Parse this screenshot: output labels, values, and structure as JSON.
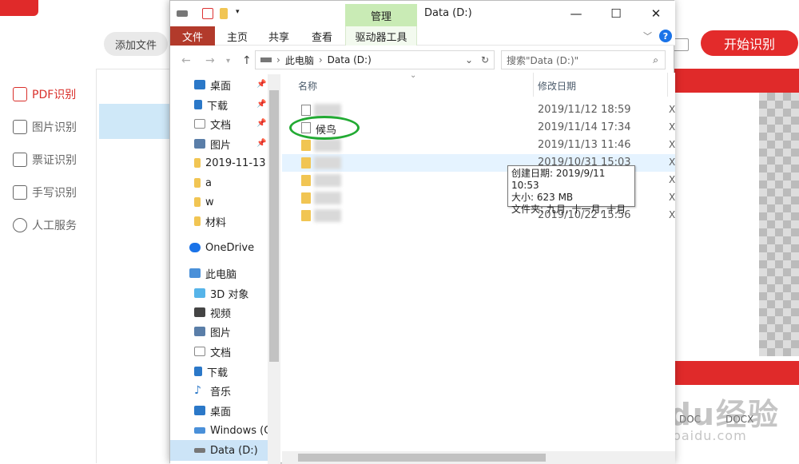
{
  "ocr_app": {
    "add_file": "添加文件",
    "start": "开始识别",
    "sidebar": [
      {
        "label": "PDF识别",
        "icon": "pdf-icon"
      },
      {
        "label": "图片识别",
        "icon": "image-icon"
      },
      {
        "label": "票证识别",
        "icon": "id-card-icon"
      },
      {
        "label": "手写识别",
        "icon": "handwriting-icon"
      },
      {
        "label": "人工服务",
        "icon": "smiley-icon"
      }
    ],
    "preview_labels": [
      "DOC",
      "DOCX"
    ]
  },
  "watermark": {
    "brand": "Baidu经验",
    "url": "jingyan.baidu.com"
  },
  "explorer": {
    "title": "Data (D:)",
    "manage_tab": "管理",
    "ribbon_tabs": [
      "文件",
      "主页",
      "共享",
      "查看",
      "驱动器工具"
    ],
    "address": [
      "此电脑",
      "Data (D:)"
    ],
    "search_placeholder": "搜索\"Data (D:)\"",
    "columns": {
      "name": "名称",
      "date": "修改日期"
    },
    "nav": [
      {
        "label": "桌面",
        "icon": "desktop-icon",
        "pinned": true
      },
      {
        "label": "下载",
        "icon": "download-icon",
        "pinned": true
      },
      {
        "label": "文档",
        "icon": "document-icon",
        "pinned": true
      },
      {
        "label": "图片",
        "icon": "picture-icon",
        "pinned": true
      },
      {
        "label": "2019-11-13",
        "icon": "folder-icon",
        "pinned": false
      },
      {
        "label": "a",
        "icon": "folder-icon",
        "pinned": false
      },
      {
        "label": "w",
        "icon": "folder-icon",
        "pinned": false
      },
      {
        "label": "材料",
        "icon": "folder-icon",
        "pinned": false
      },
      {
        "label": "OneDrive",
        "icon": "cloud-icon",
        "pinned": false
      },
      {
        "label": "此电脑",
        "icon": "computer-icon",
        "pinned": false
      },
      {
        "label": "3D 对象",
        "icon": "cube-icon",
        "pinned": false
      },
      {
        "label": "视频",
        "icon": "video-icon",
        "pinned": false
      },
      {
        "label": "图片",
        "icon": "picture-icon",
        "pinned": false
      },
      {
        "label": "文档",
        "icon": "document-icon",
        "pinned": false
      },
      {
        "label": "下载",
        "icon": "download-icon",
        "pinned": false
      },
      {
        "label": "音乐",
        "icon": "music-icon",
        "pinned": false
      },
      {
        "label": "桌面",
        "icon": "desktop-icon",
        "pinned": false
      },
      {
        "label": "Windows (C",
        "icon": "drive-icon",
        "pinned": false
      },
      {
        "label": "Data (D:)",
        "icon": "drive-icon",
        "pinned": false
      }
    ],
    "files": [
      {
        "name": "",
        "type": "doc",
        "date": "2019/11/12 18:59"
      },
      {
        "name": "候鸟",
        "type": "doc",
        "date": "2019/11/14 17:34"
      },
      {
        "name": "",
        "type": "folder",
        "date": "2019/11/13 11:46"
      },
      {
        "name": "",
        "type": "folder",
        "date": "2019/10/31 15:03"
      },
      {
        "name": "",
        "type": "folder",
        "date": ""
      },
      {
        "name": "",
        "type": "folder",
        "date": ""
      },
      {
        "name": "",
        "type": "folder",
        "date": "2019/10/22 15:56"
      }
    ],
    "tooltip": {
      "created": "创建日期: 2019/9/11 10:53",
      "size": "大小: 623 MB",
      "folders": "文件夹: 九月, 十一月, 十月"
    }
  }
}
